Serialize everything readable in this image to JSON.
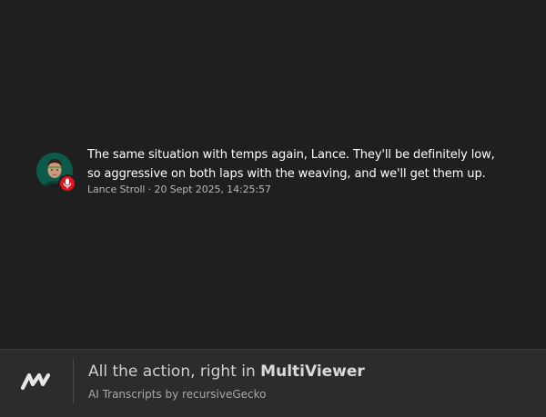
{
  "transcript": {
    "message": {
      "text": "The same situation with temps again, Lance. They'll be definitely low, so aggressive on both laps with the weaving, and we'll get them up.",
      "meta": "Lance Stroll · 20 Sept 2025, 14:25:57",
      "avatar_icon": "driver-avatar",
      "badge_icon": "microphone-icon",
      "badge_color": "#e0121b",
      "avatar_bg_color": "#0d5a4a"
    }
  },
  "footer": {
    "logo_icon": "multiviewer-logo",
    "title_prefix": "All the action, right in ",
    "title_brand": "MultiViewer",
    "subtitle": "AI Transcripts by recursiveGecko"
  },
  "colors": {
    "background": "#1f1f1f",
    "footer_background": "#2c2c2c"
  }
}
